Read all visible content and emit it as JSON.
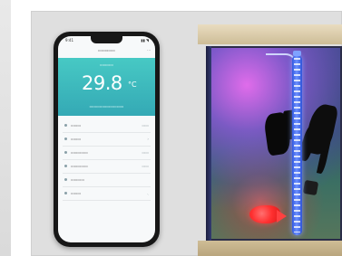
{
  "phone": {
    "time": "9:41",
    "temp_value": "29.8",
    "temp_unit": "°C"
  }
}
